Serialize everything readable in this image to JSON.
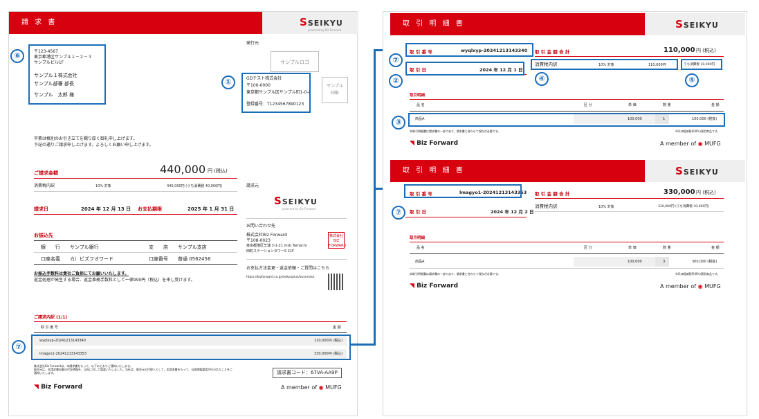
{
  "left": {
    "header_title": "請 求 書",
    "logo_text": "SEIKYU",
    "logo_sub": "powered by Biz Forward",
    "recipient": {
      "postal": "〒123-4567",
      "address1": "東京都港区サンプル１－２－３",
      "address2": "サンプルビル1F",
      "company": "サンプル１株式会社",
      "department": "サンプル部署 部長",
      "person": "サンプル　太郎 様"
    },
    "issuer_label": "発行元",
    "sample_logo": "サンプルロゴ",
    "issuer": {
      "company": "GDテスト株式会社",
      "postal": "〒100-0000",
      "address": "東京都サンプル区サンプル町1-0-0",
      "reg_no": "登録番号：T1234567890123"
    },
    "sample_seal": "サンプル\n印影",
    "greeting1": "平素は格別のお引き立てを賜り厚く御礼申し上げます。",
    "greeting2": "下記の通りご請求申し上げます。よろしくお願い申し上げます。",
    "billing_amount_label": "ご請求金額",
    "billing_amount": "440,000",
    "billing_unit": "円 (税込)",
    "tax_breakdown_label": "消費税内訳",
    "tax_rate_label": "10% 対象",
    "tax_breakdown_value": "440,000円 (うち消費税 40,000円)",
    "billing_date_label": "請求日",
    "billing_date": "2024 年 12 月 13 日",
    "due_date_label": "お支払期限",
    "due_date": "2025 年 1 月 31 日",
    "transfer_label": "お振込先",
    "bank_label": "銀　　行",
    "bank_name": "サンプル銀行",
    "branch_label": "支　　店",
    "branch_name": "サンプル支店",
    "holder_label": "口座名義",
    "holder_name": "カ）ビズフオワード",
    "account_label": "口座番号",
    "account_no": "普通 0562456",
    "fee_note_bold": "お振込手数料は貴社ご負担にてお願いいたします。",
    "fee_note": "返金処理が発生する場合、返金事務手数料として一律990円（税込）を申し受けます。",
    "biller_label": "請求元",
    "contact_label": "お問い合わせ先",
    "contact": {
      "company": "株式会社Biz Forward",
      "postal": "〒108-0023",
      "address": "東京都港区芝浦 3-1-21 msb Tamachi",
      "building": "田町ステーションタワーS 21F"
    },
    "seal_text": "株式会社BIZ FORWARD",
    "payment_change_label": "お支払方法変更・返金依頼・ご質問はこちら",
    "payment_url": "https://bizforward.co.jp/seikyuplus/buyer/ask",
    "details_label": "ご請求内訳 (1/1)",
    "col_txn_no": "取 引 番 号",
    "col_amount": "金 額",
    "rows": [
      {
        "no": "wyqlxyp-20241213143340",
        "amount": "110,000円 (税込)"
      },
      {
        "no": "lmagyo1-20241213143353",
        "amount": "330,000円 (税込)"
      }
    ],
    "footer_note1": "株式会社Biz Forwardは、本請求書をもって、以下のとおりご通知いたします。",
    "footer_note2": "販売元は、本請求書記載の代金債権を、当社に対して譲渡いたしました。当社は、販売元の代理人として、本請求書をもって、当該債権譲渡が行われたことをご",
    "footer_note3": "通知いたします。",
    "invoice_code": "請求書コード：67VA-AA9P",
    "bf_brand": "Biz Forward",
    "member_of": "A member of",
    "mufg": "MUFG"
  },
  "statements": [
    {
      "header_title": "取 引 明 細 書",
      "txn_no_label": "取 引 番 号",
      "txn_no": "wyqlxyp-20241213143340",
      "txn_date_label": "取 引 日",
      "txn_date": "2024 年 12 月 1 日",
      "total_label": "取 引 金 額 合 計",
      "total": "110,000",
      "total_unit": "円 (税込)",
      "tax_label": "消費税内訳",
      "tax_rate": "10% 対象",
      "tax_base": "110,000円",
      "tax_amount": "うち消費税 10,000円",
      "details_label": "取引明細",
      "col_item": "品 名",
      "col_category": "区 分",
      "col_unit_price": "単 価",
      "col_qty": "数 量",
      "col_amount": "金 額",
      "item": {
        "name": "商品A",
        "unit_price": "100,000",
        "qty": "1",
        "amount": "100,000 (税抜)"
      },
      "note_left": "本取引明細書は請求書の一部であり、請求書と合わせて保存が必要です。",
      "note_right": "※印は軽減税率(8%)適用商品です。"
    },
    {
      "header_title": "取 引 明 細 書",
      "txn_no_label": "取 引 番 号",
      "txn_no": "lmagyo1-20241213143353",
      "txn_date_label": "取 引 日",
      "txn_date": "2024 年 12 月 2 日",
      "total_label": "取 引 金 額 合 計",
      "total": "330,000",
      "total_unit": "円 (税込)",
      "tax_label": "消費税内訳",
      "tax_rate": "10% 対象",
      "tax_combined": "330,000円 (うち消費税 30,000円)",
      "details_label": "取引明細",
      "col_item": "品 名",
      "col_category": "区 分",
      "col_unit_price": "単 価",
      "col_qty": "数 量",
      "col_amount": "金 額",
      "item": {
        "name": "商品A",
        "unit_price": "100,000",
        "qty": "3",
        "amount": "300,000 (税抜)"
      },
      "note_left": "本取引明細書は請求書の一部であり、請求書と合わせて保存が必要です。",
      "note_right": "※印は軽減税率(8%)適用商品です。"
    }
  ],
  "annotations": {
    "n1": "①",
    "n2": "②",
    "n3": "③",
    "n4": "④",
    "n5": "⑤",
    "n6": "⑥",
    "n7": "⑦"
  },
  "colors": {
    "brand_red": "#d7000f",
    "annotation_blue": "#1c6db8"
  }
}
